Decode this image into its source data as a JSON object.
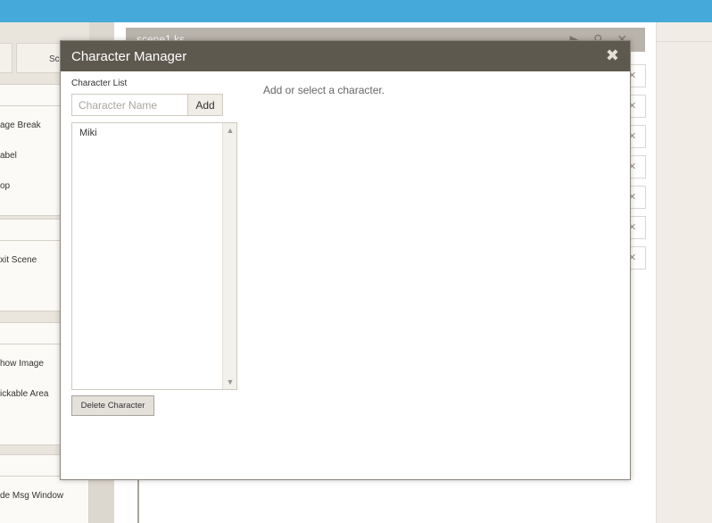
{
  "background": {
    "tab_label": "Sc",
    "panel1_items": [
      "age Break",
      "abel",
      "op"
    ],
    "panel2_items": [
      "xit Scene"
    ],
    "panel3_items": [
      "how Image",
      "ickable Area"
    ],
    "panel4_items": [
      "de Msg Window"
    ],
    "editor_title": "scene1.ks",
    "editor_icons": "▶ ⚲ ✕",
    "stub_glyph": "✕"
  },
  "modal": {
    "title": "Character Manager",
    "close_glyph": "✖",
    "list_label": "Character List",
    "name_placeholder": "Character Name",
    "add_label": "Add",
    "characters": [
      "Miki"
    ],
    "delete_label": "Delete Character",
    "hint": "Add or select a character.",
    "scroll_up_glyph": "▲",
    "scroll_down_glyph": "▼"
  },
  "colors": {
    "topbar": "#45a9d9",
    "modal_header": "#5e594e",
    "editor_title_bar": "#b9b4ab"
  }
}
